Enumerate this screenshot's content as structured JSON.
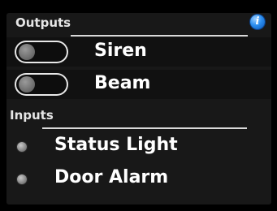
{
  "outputs": {
    "title": "Outputs",
    "items": [
      {
        "label": "Siren",
        "state": "off"
      },
      {
        "label": "Beam",
        "state": "off"
      }
    ]
  },
  "inputs": {
    "title": "Inputs",
    "items": [
      {
        "label": "Status Light",
        "state": "off"
      },
      {
        "label": "Door Alarm",
        "state": "off"
      }
    ]
  },
  "icons": {
    "info": "info-icon"
  },
  "colors": {
    "background": "#000000",
    "panel": "#181818",
    "text": "#ffffff",
    "toggle_off_knob": "#6f6f6f",
    "led_off": "#8a8a8a",
    "info_accent": "#2b8ef0"
  }
}
